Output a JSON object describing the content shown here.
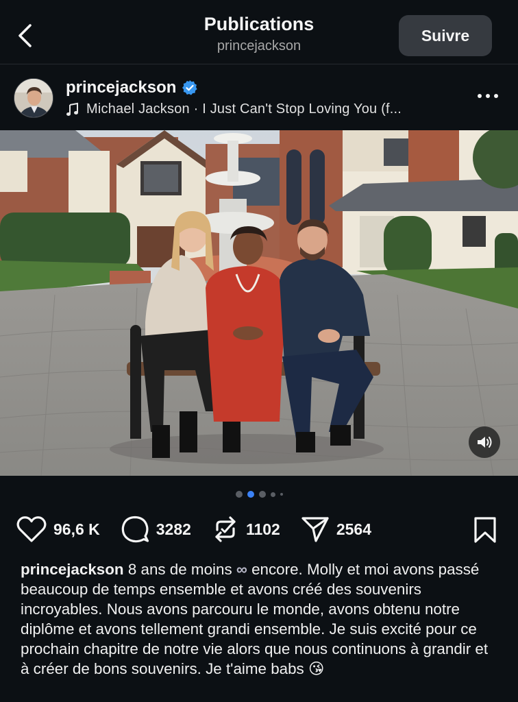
{
  "header": {
    "title": "Publications",
    "subtitle": "princejackson",
    "follow_label": "Suivre"
  },
  "post": {
    "username": "princejackson",
    "verified": true,
    "music": "Michael Jackson · I Just Can't Stop Loving You (f...",
    "carousel": {
      "current": 2,
      "dots": 5
    }
  },
  "actions": {
    "likes": "96,6 K",
    "comments": "3282",
    "reposts": "1102",
    "shares": "2564"
  },
  "caption": {
    "username": "princejackson",
    "text_before_emoji": " 8 ans de moins ",
    "infinity": "∞",
    "text": " encore. Molly et moi avons passé beaucoup de temps ensemble et avons créé des souvenirs incroyables. Nous avons parcouru le monde, avons obtenu notre diplôme et avons tellement grandi ensemble. Je suis excité pour ce prochain chapitre de notre vie alors que nous continuons à grandir et à créer de bons souvenirs. Je t'aime babs ",
    "emoji": "😘"
  },
  "colors": {
    "background": "#0c1014",
    "accent": "#3b82f6",
    "button_bg": "#363a40"
  },
  "icons": [
    "back-chevron-icon",
    "verified-badge-icon",
    "music-note-icon",
    "more-icon",
    "volume-icon",
    "heart-icon",
    "comment-icon",
    "repost-icon",
    "share-icon",
    "bookmark-icon"
  ]
}
